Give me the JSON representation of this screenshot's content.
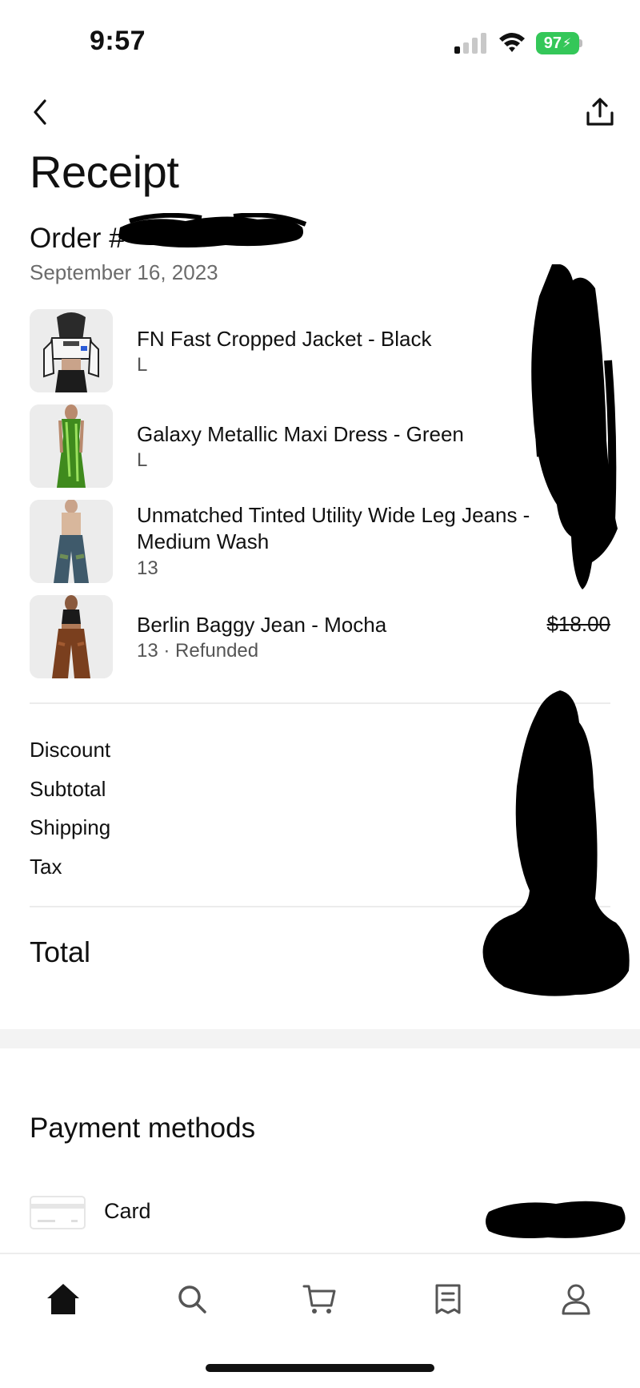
{
  "status_bar": {
    "time": "9:57",
    "battery": "97"
  },
  "header": {
    "title": "Receipt"
  },
  "order": {
    "label": "Order #",
    "date": "September 16, 2023"
  },
  "items": [
    {
      "name": "FN Fast Cropped Jacket - Black",
      "variant": "L",
      "price": ""
    },
    {
      "name": "Galaxy Metallic Maxi Dress - Green",
      "variant": "L",
      "price": ""
    },
    {
      "name": "Unmatched Tinted Utility Wide Leg Jeans - Medium Wash",
      "variant": "13",
      "price": ""
    },
    {
      "name": "Berlin Baggy Jean - Mocha",
      "variant": "13 · Refunded",
      "price": "$18.00"
    }
  ],
  "summary": {
    "discount_label": "Discount",
    "subtotal_label": "Subtotal",
    "shipping_label": "Shipping",
    "tax_label": "Tax",
    "total_label": "Total"
  },
  "payment": {
    "title": "Payment methods",
    "card_label": "Card"
  },
  "tab_bar": {
    "tabs": [
      {
        "icon": "home-icon",
        "active": true
      },
      {
        "icon": "search-icon",
        "active": false
      },
      {
        "icon": "cart-icon",
        "active": false
      },
      {
        "icon": "orders-icon",
        "active": false
      },
      {
        "icon": "profile-icon",
        "active": false
      }
    ]
  },
  "colors": {
    "battery": "#34c759",
    "text": "#111111",
    "muted": "#6b6b6b",
    "redaction": "#000000"
  }
}
